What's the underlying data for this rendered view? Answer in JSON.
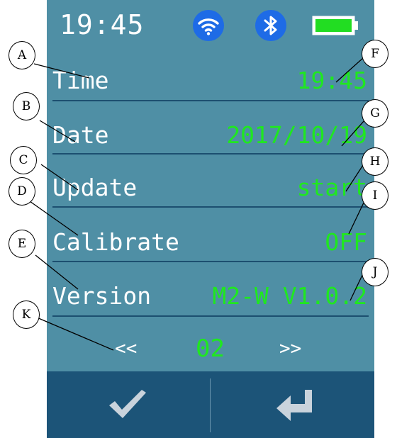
{
  "status_bar": {
    "time": "19:45",
    "icons": [
      "wifi-icon",
      "bluetooth-icon",
      "battery-icon"
    ],
    "battery_level": 1.0
  },
  "settings": [
    {
      "label": "Time",
      "value": "19:45"
    },
    {
      "label": "Date",
      "value": "2017/10/19"
    },
    {
      "label": "Update",
      "value": "start"
    },
    {
      "label": "Calibrate",
      "value": "OFF"
    },
    {
      "label": "Version",
      "value": "M2-W V1.0.2"
    }
  ],
  "pager": {
    "prev": "<<",
    "page": "02",
    "next": ">>"
  },
  "bottom_bar": {
    "icons": [
      "checkmark-icon",
      "enter-return-icon"
    ]
  },
  "callouts": [
    "A",
    "B",
    "C",
    "D",
    "E",
    "F",
    "G",
    "H",
    "I",
    "J",
    "K"
  ],
  "colors": {
    "screen_bg": "#4f8fa5",
    "value_text": "#1fe81f",
    "label_text": "#ffffff",
    "separator": "#1c4f70",
    "bottom_bar": "#1c5478",
    "status_icon": "#1e6be6",
    "battery": "#22dd22"
  }
}
